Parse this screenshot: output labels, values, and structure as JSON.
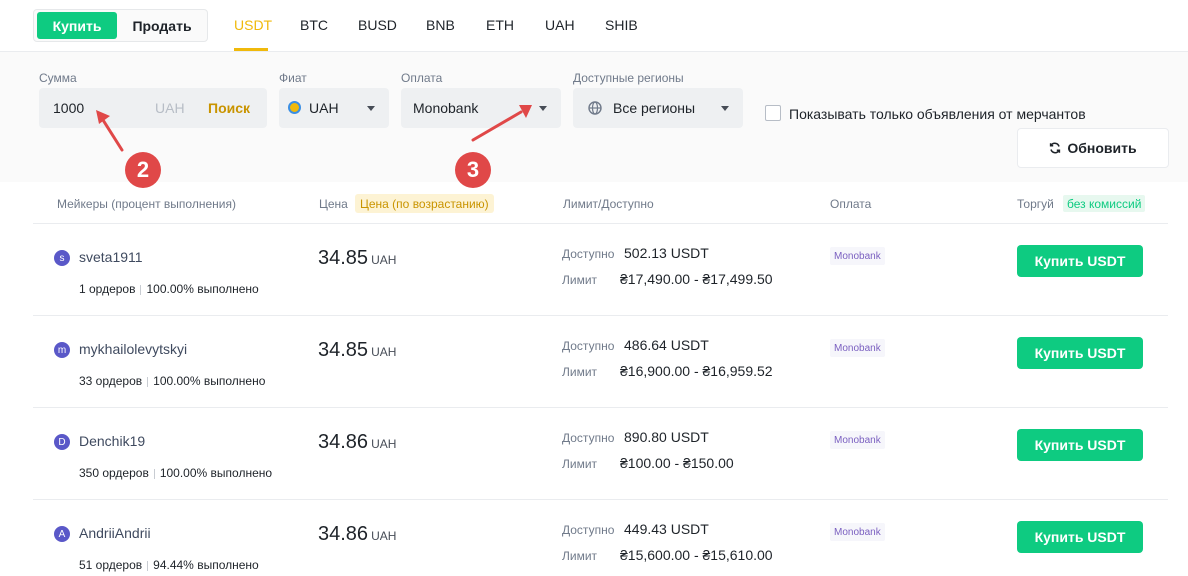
{
  "header": {
    "buy_label": "Купить",
    "sell_label": "Продать",
    "coin_tabs": [
      "USDT",
      "BTC",
      "BUSD",
      "BNB",
      "ETH",
      "UAH",
      "SHIB"
    ],
    "active_tab": "USDT"
  },
  "filters": {
    "amount_label": "Сумма",
    "amount_value": "1000",
    "amount_currency": "UAH",
    "search_label": "Поиск",
    "fiat_label": "Фиат",
    "fiat_value": "UAH",
    "payment_label": "Оплата",
    "payment_value": "Monobank",
    "regions_label": "Доступные регионы",
    "regions_value": "Все регионы",
    "merchants_only_label": "Показывать только объявления от мерчантов",
    "refresh_label": "Обновить"
  },
  "annotations": [
    "2",
    "3"
  ],
  "table": {
    "col_makers": "Мейкеры (процент выполнения)",
    "col_price": "Цена",
    "price_sort_chip": "Цена (по возрастанию)",
    "col_limit": "Лимит/Доступно",
    "col_payment": "Оплата",
    "col_trade": "Торгуй",
    "fee_chip": "без комиссий",
    "available_label": "Доступно",
    "limit_label": "Лимит",
    "rows": [
      {
        "initial": "s",
        "name": "sveta1911",
        "orders": "1 ордеров",
        "completion": "100.00% выполнено",
        "price": "34.85",
        "currency": "UAH",
        "available": "502.13 USDT",
        "limit": "₴17,490.00 - ₴17,499.50",
        "payment": "Monobank",
        "button": "Купить USDT"
      },
      {
        "initial": "m",
        "name": "mykhailolevytskyi",
        "orders": "33 ордеров",
        "completion": "100.00% выполнено",
        "price": "34.85",
        "currency": "UAH",
        "available": "486.64 USDT",
        "limit": "₴16,900.00 - ₴16,959.52",
        "payment": "Monobank",
        "button": "Купить USDT"
      },
      {
        "initial": "D",
        "name": "Denchik19",
        "orders": "350 ордеров",
        "completion": "100.00% выполнено",
        "price": "34.86",
        "currency": "UAH",
        "available": "890.80 USDT",
        "limit": "₴100.00 - ₴150.00",
        "payment": "Monobank",
        "button": "Купить USDT"
      },
      {
        "initial": "A",
        "name": "AndriiAndrii",
        "orders": "51 ордеров",
        "completion": "94.44% выполнено",
        "price": "34.86",
        "currency": "UAH",
        "available": "449.43 USDT",
        "limit": "₴15,600.00 - ₴15,610.00",
        "payment": "Monobank",
        "button": "Купить USDT"
      }
    ]
  }
}
